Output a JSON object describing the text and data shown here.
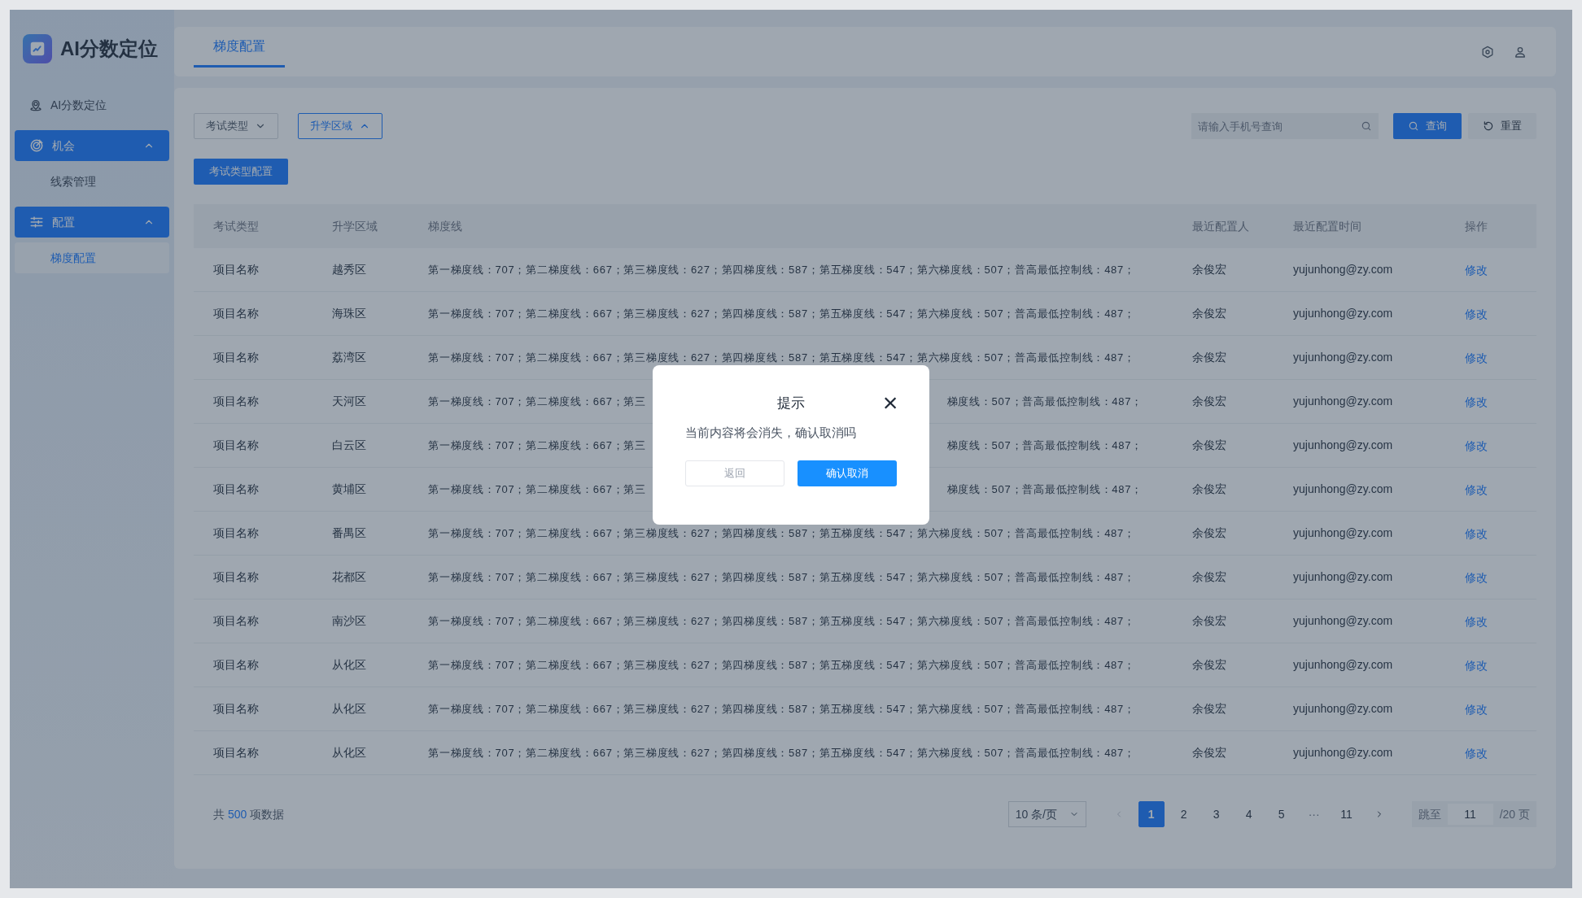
{
  "app": {
    "logo_text": "AI分数定位"
  },
  "sidebar": {
    "items": [
      {
        "kind": "link",
        "label": "AI分数定位",
        "selected": false
      },
      {
        "kind": "group",
        "label": "机会",
        "expanded": true,
        "children": [
          {
            "label": "线索管理",
            "selected": false
          }
        ]
      },
      {
        "kind": "group",
        "label": "配置",
        "expanded": true,
        "children": [
          {
            "label": "梯度配置",
            "selected": true
          }
        ]
      }
    ]
  },
  "header": {
    "tabs": [
      {
        "label": "梯度配置",
        "selected": true
      }
    ]
  },
  "filters": [
    {
      "label": "考试类型",
      "expanded": false
    },
    {
      "label": "升学区域",
      "expanded": true
    }
  ],
  "search": {
    "placeholder": "请输入手机号查询"
  },
  "query_button": "查询",
  "reset_button": "重置",
  "config_button": "考试类型配置",
  "table": {
    "columns": [
      "考试类型",
      "升学区域",
      "梯度线",
      "最近配置人",
      "最近配置时间",
      "操作"
    ],
    "rows": [
      {
        "type": "项目名称",
        "region": "越秀区",
        "lines": [
          "第一梯度线：707；第二梯度线：667；第三梯度线：627；第四梯度线：587；第五梯度线：547；第六梯度线：507；普高最低控制线：487；"
        ],
        "person": "余俊宏",
        "email": "yujunhong@zy.com",
        "action": "修改"
      },
      {
        "type": "项目名称",
        "region": "海珠区",
        "lines": [
          "第一梯度线：707；第二梯度线：667；第三梯度线：627；第四梯度线：587；第五梯度线：547；第六梯度线：507；普高最低控制线：487；"
        ],
        "person": "余俊宏",
        "email": "yujunhong@zy.com",
        "action": "修改"
      },
      {
        "type": "项目名称",
        "region": "荔湾区",
        "lines": [
          "第一梯度线：707；第二梯度线：667；第三梯度线：627；第四梯度线：587；第五梯度线：547；第六梯度线：507；普高最低控制线：487；"
        ],
        "person": "余俊宏",
        "email": "yujunhong@zy.com",
        "action": "修改"
      },
      {
        "type": "项目名称",
        "region": "天河区",
        "lines": [
          "第一梯度线：707；第二梯度线：667；第三",
          "梯度线：507；普高最低控制线：487；"
        ],
        "person": "余俊宏",
        "email": "yujunhong@zy.com",
        "action": "修改"
      },
      {
        "type": "项目名称",
        "region": "白云区",
        "lines": [
          "第一梯度线：707；第二梯度线：667；第三",
          "梯度线：507；普高最低控制线：487；"
        ],
        "person": "余俊宏",
        "email": "yujunhong@zy.com",
        "action": "修改"
      },
      {
        "type": "项目名称",
        "region": "黄埔区",
        "lines": [
          "第一梯度线：707；第二梯度线：667；第三",
          "梯度线：507；普高最低控制线：487；"
        ],
        "person": "余俊宏",
        "email": "yujunhong@zy.com",
        "action": "修改"
      },
      {
        "type": "项目名称",
        "region": "番禺区",
        "lines": [
          "第一梯度线：707；第二梯度线：667；第三梯度线：627；第四梯度线：587；第五梯度线：547；第六梯度线：507；普高最低控制线：487；"
        ],
        "person": "余俊宏",
        "email": "yujunhong@zy.com",
        "action": "修改"
      },
      {
        "type": "项目名称",
        "region": "花都区",
        "lines": [
          "第一梯度线：707；第二梯度线：667；第三梯度线：627；第四梯度线：587；第五梯度线：547；第六梯度线：507；普高最低控制线：487；"
        ],
        "person": "余俊宏",
        "email": "yujunhong@zy.com",
        "action": "修改"
      },
      {
        "type": "项目名称",
        "region": "南沙区",
        "lines": [
          "第一梯度线：707；第二梯度线：667；第三梯度线：627；第四梯度线：587；第五梯度线：547；第六梯度线：507；普高最低控制线：487；"
        ],
        "person": "余俊宏",
        "email": "yujunhong@zy.com",
        "action": "修改"
      },
      {
        "type": "项目名称",
        "region": "从化区",
        "lines": [
          "第一梯度线：707；第二梯度线：667；第三梯度线：627；第四梯度线：587；第五梯度线：547；第六梯度线：507；普高最低控制线：487；"
        ],
        "person": "余俊宏",
        "email": "yujunhong@zy.com",
        "action": "修改"
      },
      {
        "type": "项目名称",
        "region": "从化区",
        "lines": [
          "第一梯度线：707；第二梯度线：667；第三梯度线：627；第四梯度线：587；第五梯度线：547；第六梯度线：507；普高最低控制线：487；"
        ],
        "person": "余俊宏",
        "email": "yujunhong@zy.com",
        "action": "修改"
      },
      {
        "type": "项目名称",
        "region": "从化区",
        "lines": [
          "第一梯度线：707；第二梯度线：667；第三梯度线：627；第四梯度线：587；第五梯度线：547；第六梯度线：507；普高最低控制线：487；"
        ],
        "person": "余俊宏",
        "email": "yujunhong@zy.com",
        "action": "修改"
      }
    ]
  },
  "pagination": {
    "total_prefix": "共",
    "total": "500",
    "total_suffix": "项数据",
    "page_size": "10 条/页",
    "pages": [
      {
        "kind": "page",
        "label": "1",
        "selected": true
      },
      {
        "kind": "page",
        "label": "2",
        "selected": false
      },
      {
        "kind": "page",
        "label": "3",
        "selected": false
      },
      {
        "kind": "page",
        "label": "4",
        "selected": false
      },
      {
        "kind": "page",
        "label": "5",
        "selected": false
      },
      {
        "kind": "ellipsis",
        "label": "···"
      },
      {
        "kind": "page",
        "label": "11",
        "selected": false
      }
    ],
    "jump_label": "跳至",
    "jump_value": "11",
    "jump_suffix": "/20 页"
  },
  "dialog": {
    "title": "提示",
    "close": "×",
    "message": "当前内容将会消失，确认取消吗",
    "buttons": [
      {
        "kind": "secondary",
        "label": "返回"
      },
      {
        "kind": "primary",
        "label": "确认取消"
      }
    ]
  }
}
